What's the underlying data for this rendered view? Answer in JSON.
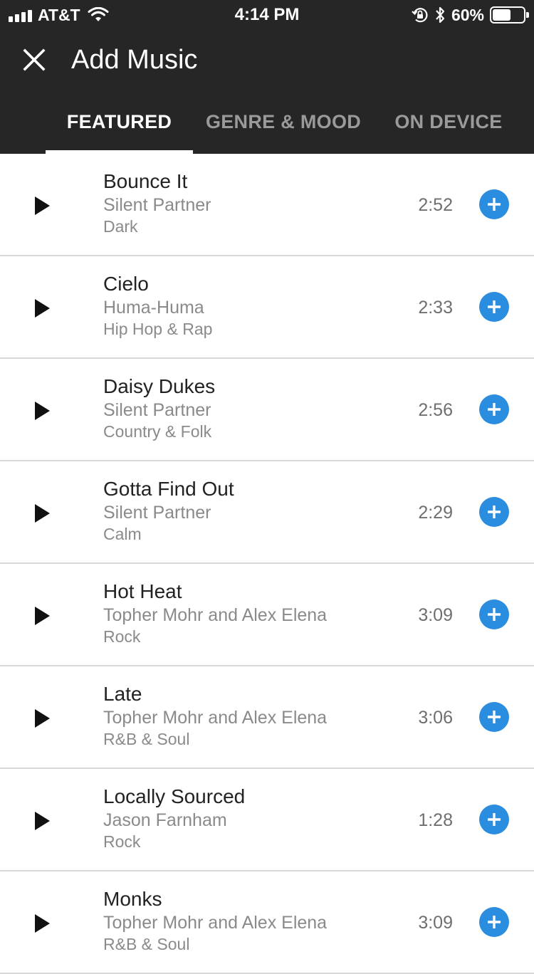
{
  "status_bar": {
    "carrier": "AT&T",
    "time": "4:14 PM",
    "battery_percent": "60%",
    "battery_level": 0.6,
    "icons": [
      "signal-icon",
      "wifi-icon",
      "rotation-lock-icon",
      "bluetooth-icon",
      "battery-icon"
    ]
  },
  "header": {
    "title": "Add Music",
    "close_icon": "close-icon",
    "background_color": "#262626"
  },
  "tabs": [
    {
      "label": "FEATURED",
      "active": true
    },
    {
      "label": "GENRE & MOOD",
      "active": false
    },
    {
      "label": "ON DEVICE",
      "active": false
    }
  ],
  "accent_color": "#2a8de0",
  "tracks": [
    {
      "title": "Bounce It",
      "artist": "Silent Partner",
      "genre": "Dark",
      "duration": "2:52"
    },
    {
      "title": "Cielo",
      "artist": "Huma-Huma",
      "genre": "Hip Hop & Rap",
      "duration": "2:33"
    },
    {
      "title": "Daisy Dukes",
      "artist": "Silent Partner",
      "genre": "Country & Folk",
      "duration": "2:56"
    },
    {
      "title": "Gotta Find Out",
      "artist": "Silent Partner",
      "genre": "Calm",
      "duration": "2:29"
    },
    {
      "title": "Hot Heat",
      "artist": "Topher Mohr and Alex Elena",
      "genre": "Rock",
      "duration": "3:09"
    },
    {
      "title": "Late",
      "artist": "Topher Mohr and Alex Elena",
      "genre": "R&B & Soul",
      "duration": "3:06"
    },
    {
      "title": "Locally Sourced",
      "artist": "Jason Farnham",
      "genre": "Rock",
      "duration": "1:28"
    },
    {
      "title": "Monks",
      "artist": "Topher Mohr and Alex Elena",
      "genre": "R&B & Soul",
      "duration": "3:09"
    }
  ]
}
